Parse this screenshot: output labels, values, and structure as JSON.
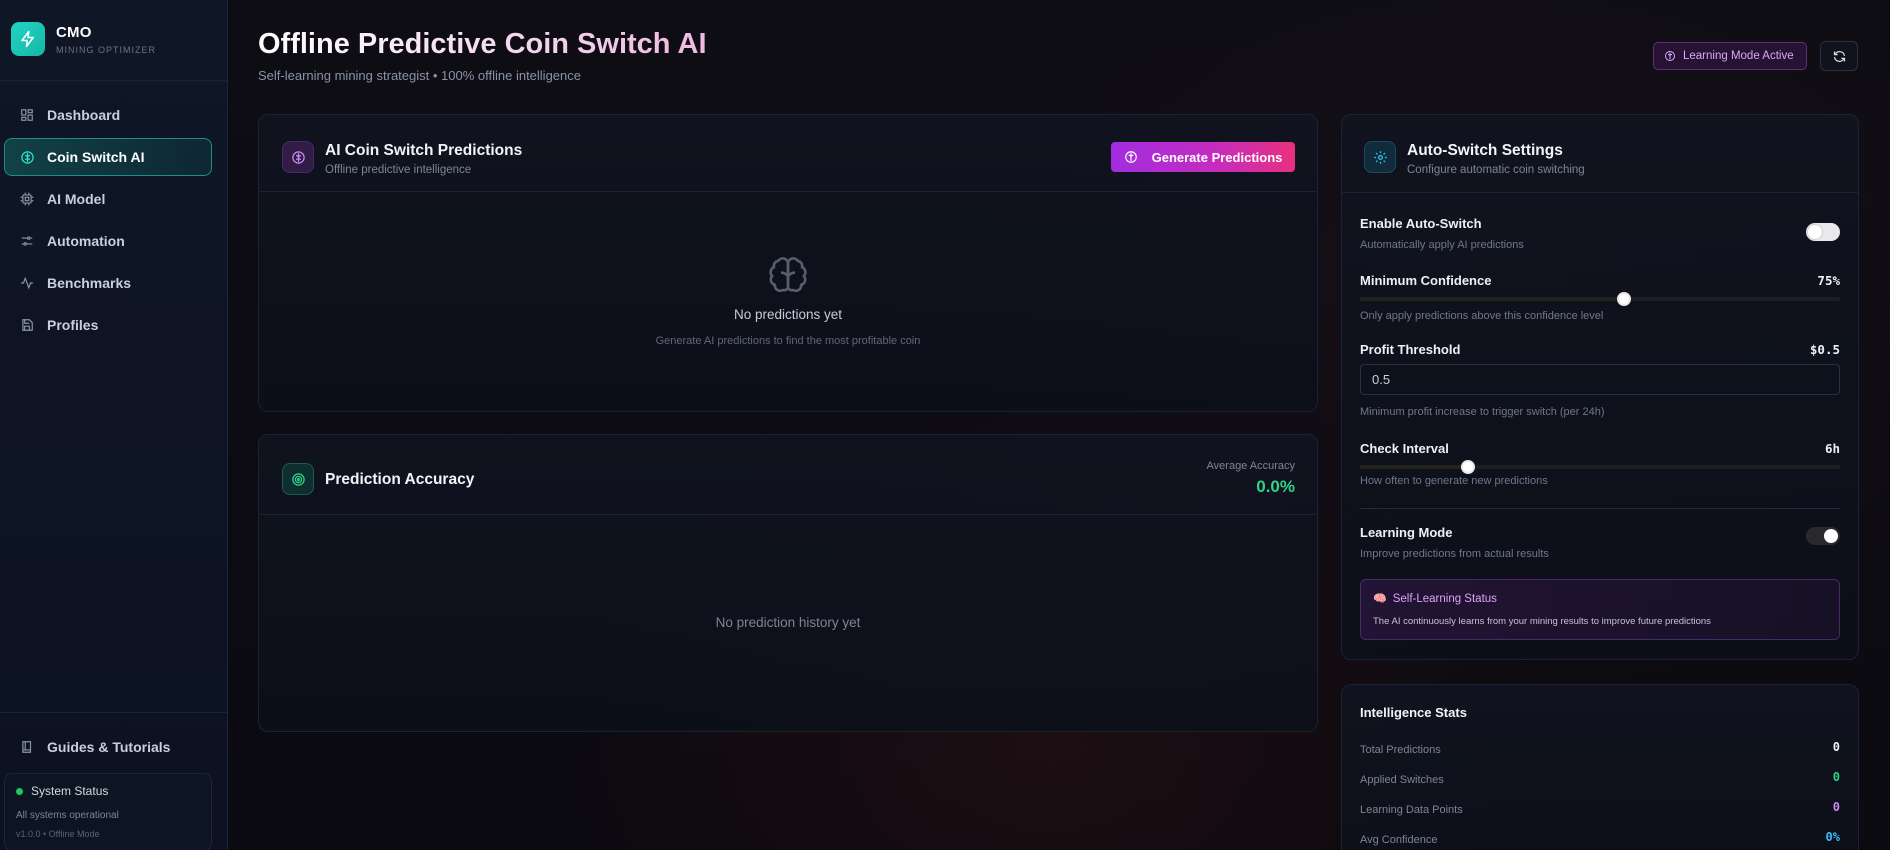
{
  "app": {
    "name": "CMO",
    "subtitle": "MINING OPTIMIZER"
  },
  "sidebar": {
    "items": [
      {
        "label": "Dashboard",
        "icon": "dashboard-icon"
      },
      {
        "label": "Coin Switch AI",
        "icon": "brain-icon",
        "active": true
      },
      {
        "label": "AI Model",
        "icon": "cpu-icon"
      },
      {
        "label": "Automation",
        "icon": "sliders-icon"
      },
      {
        "label": "Benchmarks",
        "icon": "activity-icon"
      },
      {
        "label": "Profiles",
        "icon": "save-icon"
      }
    ],
    "guides_label": "Guides & Tutorials",
    "status": {
      "title": "System Status",
      "message": "All systems operational",
      "version": "v1.0.0 • Offline Mode"
    }
  },
  "header": {
    "title": "Offline Predictive Coin Switch AI",
    "subtitle": "Self-learning mining strategist • 100% offline intelligence",
    "badge": "Learning Mode Active"
  },
  "predictions": {
    "title": "AI Coin Switch Predictions",
    "subtitle": "Offline predictive intelligence",
    "button": "Generate Predictions",
    "empty_title": "No predictions yet",
    "empty_sub": "Generate AI predictions to find the most profitable coin"
  },
  "accuracy": {
    "title": "Prediction Accuracy",
    "avg_label": "Average Accuracy",
    "avg_value": "0.0%",
    "empty": "No prediction history yet"
  },
  "settings": {
    "title": "Auto-Switch Settings",
    "subtitle": "Configure automatic coin switching",
    "auto_switch": {
      "label": "Enable Auto-Switch",
      "help": "Automatically apply AI predictions",
      "enabled": false
    },
    "min_confidence": {
      "label": "Minimum Confidence",
      "value": "75%",
      "help": "Only apply predictions above this confidence level",
      "level": 0.55
    },
    "profit_threshold": {
      "label": "Profit Threshold",
      "value": "$0.5",
      "input": "0.5",
      "help": "Minimum profit increase to trigger switch (per 24h)"
    },
    "check_interval": {
      "label": "Check Interval",
      "value": "6h",
      "help": "How often to generate new predictions",
      "level": 0.226
    },
    "learning_mode": {
      "label": "Learning Mode",
      "help": "Improve predictions from actual results",
      "enabled": true
    },
    "self_learning": {
      "title": "Self-Learning Status",
      "emoji": "🧠",
      "text": "The AI continuously learns from your mining results to improve future predictions"
    }
  },
  "stats": {
    "title": "Intelligence Stats",
    "rows": [
      {
        "label": "Total Predictions",
        "value": "0",
        "color": "#f1f3f7"
      },
      {
        "label": "Applied Switches",
        "value": "0",
        "color": "#2fd38a"
      },
      {
        "label": "Learning Data Points",
        "value": "0",
        "color": "#c58af5"
      },
      {
        "label": "Avg Confidence",
        "value": "0%",
        "color": "#38bdf8"
      }
    ]
  },
  "colors": {
    "accent_teal": "#14b8a6",
    "accent_purple": "#a12de0",
    "accent_pink": "#e8307f",
    "success": "#22c55e"
  }
}
